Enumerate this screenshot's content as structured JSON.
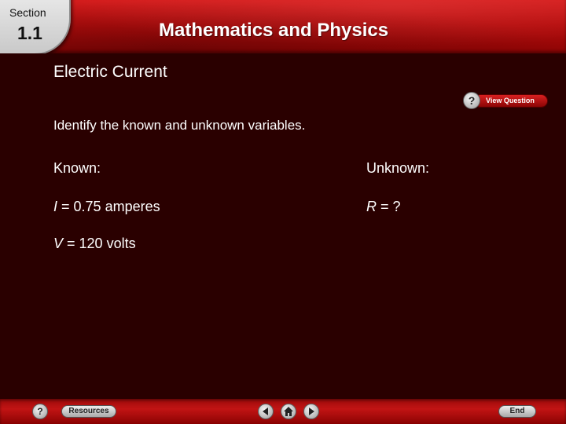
{
  "header": {
    "section_label": "Section",
    "section_number": "1.1",
    "title": "Mathematics and Physics"
  },
  "slide": {
    "heading": "Electric Current",
    "instruction": "Identify the known and unknown variables.",
    "known_label": "Known:",
    "unknown_label": "Unknown:",
    "known_items": [
      {
        "variable": "I",
        "expression": " = 0.75 amperes"
      },
      {
        "variable": "V",
        "expression": " = 120 volts"
      }
    ],
    "unknown_items": [
      {
        "variable": "R",
        "expression": " = ?"
      }
    ]
  },
  "view_question": {
    "label": "View Question",
    "icon": "question-icon"
  },
  "footer": {
    "help_icon": "question-icon",
    "resources_label": "Resources",
    "prev_icon": "triangle-left-icon",
    "home_icon": "house-icon",
    "next_icon": "triangle-right-icon",
    "end_label": "End"
  },
  "colors": {
    "background": "#2a0000",
    "header_red": "#c21414",
    "text": "#ffffff"
  }
}
